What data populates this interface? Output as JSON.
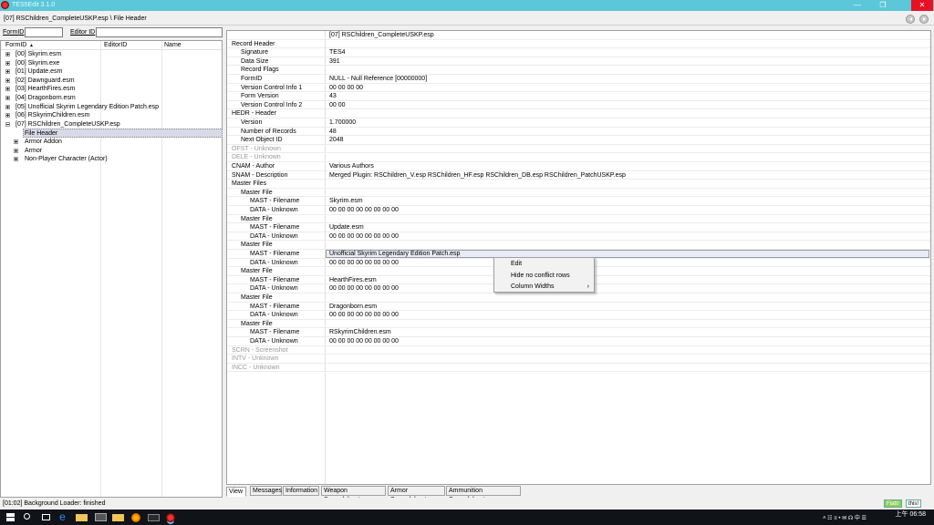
{
  "window": {
    "title": "TES5Edit 3.1.0",
    "minimize": "—",
    "restore": "❒",
    "close": "✕"
  },
  "pathbar": {
    "path": "[07] RSChildren_CompleteUSKP.esp \\ File Header"
  },
  "filters": {
    "formid_label": "FormID",
    "editorid_label": "Editor ID",
    "formid_value": "",
    "editorid_value": ""
  },
  "tree": {
    "columns": [
      "FormID",
      "EditorID",
      "Name"
    ],
    "sort_indicator": "▲",
    "nodes": [
      {
        "label": "[00] Skyrim.esm"
      },
      {
        "label": "[00] Skyrim.exe"
      },
      {
        "label": "[01] Update.esm"
      },
      {
        "label": "[02] Dawnguard.esm"
      },
      {
        "label": "[03] HearthFires.esm"
      },
      {
        "label": "[04] Dragonborn.esm"
      },
      {
        "label": "[05] Unofficial Skyrim Legendary Edition Patch.esp"
      },
      {
        "label": "[06] RSkyrimChildren.esm"
      },
      {
        "label": "[07] RSChildren_CompleteUSKP.esp"
      },
      {
        "label": "File Header"
      },
      {
        "label": "Armor Addon"
      },
      {
        "label": "Armor"
      },
      {
        "label": "Non-Player Character (Actor)"
      }
    ]
  },
  "record": {
    "header": "[07] RSChildren_CompleteUSKP.esp",
    "rows": [
      {
        "label": "Record Header",
        "value": ""
      },
      {
        "label": "Signature",
        "value": "TES4"
      },
      {
        "label": "Data Size",
        "value": "391"
      },
      {
        "label": "Record Flags",
        "value": ""
      },
      {
        "label": "FormID",
        "value": "NULL - Null Reference [00000000]"
      },
      {
        "label": "Version Control Info 1",
        "value": "00 00 00 00"
      },
      {
        "label": "Form Version",
        "value": "43"
      },
      {
        "label": "Version Control Info 2",
        "value": "00 00"
      },
      {
        "label": "HEDR - Header",
        "value": ""
      },
      {
        "label": "Version",
        "value": "1.700000"
      },
      {
        "label": "Number of Records",
        "value": "48"
      },
      {
        "label": "Next Object ID",
        "value": "2048"
      },
      {
        "label": "OFST - Unknown",
        "value": ""
      },
      {
        "label": "DELE - Unknown",
        "value": ""
      },
      {
        "label": "CNAM - Author",
        "value": "Various Authors"
      },
      {
        "label": "SNAM - Description",
        "value": "Merged Plugin:   RSChildren_V.esp   RSChildren_HF.esp   RSChildren_DB.esp   RSChildren_PatchUSKP.esp"
      },
      {
        "label": "Master Files",
        "value": ""
      },
      {
        "label": "Master File",
        "value": ""
      },
      {
        "label": "MAST - Filename",
        "value": "Skyrim.esm"
      },
      {
        "label": "DATA - Unknown",
        "value": "00 00 00 00 00 00 00 00"
      },
      {
        "label": "Master File",
        "value": ""
      },
      {
        "label": "MAST - Filename",
        "value": "Update.esm"
      },
      {
        "label": "DATA - Unknown",
        "value": "00 00 00 00 00 00 00 00"
      },
      {
        "label": "Master File",
        "value": ""
      },
      {
        "label": "MAST - Filename",
        "value": "Unofficial Skyrim Legendary Edition Patch.esp"
      },
      {
        "label": "DATA - Unknown",
        "value": "00 00 00 00 00 00 00 00"
      },
      {
        "label": "Master File",
        "value": ""
      },
      {
        "label": "MAST - Filename",
        "value": "HearthFires.esm"
      },
      {
        "label": "DATA - Unknown",
        "value": "00 00 00 00 00 00 00 00"
      },
      {
        "label": "Master File",
        "value": ""
      },
      {
        "label": "MAST - Filename",
        "value": "Dragonborn.esm"
      },
      {
        "label": "DATA - Unknown",
        "value": "00 00 00 00 00 00 00 00"
      },
      {
        "label": "Master File",
        "value": ""
      },
      {
        "label": "MAST - Filename",
        "value": "RSkyrimChildren.esm"
      },
      {
        "label": "DATA - Unknown",
        "value": "00 00 00 00 00 00 00 00"
      },
      {
        "label": "SCRN - Screenshot",
        "value": ""
      },
      {
        "label": "INTV - Unknown",
        "value": ""
      },
      {
        "label": "INCC - Unknown",
        "value": ""
      }
    ]
  },
  "context_menu": {
    "items": [
      "Edit",
      "Hide no conflict rows",
      "Column Widths"
    ],
    "submenu_arrow": "›"
  },
  "tabs": [
    "View",
    "Messages",
    "Information",
    "Weapon Spreadsheet",
    "Armor Spreadsheet",
    "Ammunition Spreadsheet"
  ],
  "status": {
    "text": "[01:02] Background Loader: finished",
    "badge1": "Flattr",
    "badge2": "this!"
  },
  "taskbar": {
    "time": "06:58",
    "ampm": "上午",
    "tray": "˄ ☷ ≡ • ✉ ☊ 中 ☰"
  },
  "colors": {
    "titlebar": "#5bc7d9",
    "close": "#e81123",
    "selection": "#d9d9e8",
    "taskbar": "#101418"
  }
}
